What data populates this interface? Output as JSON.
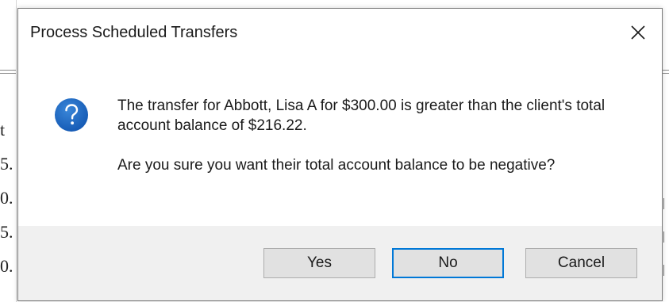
{
  "background": {
    "fragments": [
      "t",
      "5.",
      "0.",
      "5.",
      "0."
    ]
  },
  "dialog": {
    "title": "Process Scheduled Transfers",
    "icon": "question-icon",
    "message_line1": "The transfer for Abbott, Lisa A for $300.00 is greater than the client's total account balance of $216.22.",
    "message_line2": "Are you sure you want their total account balance to be negative?",
    "buttons": {
      "yes": "Yes",
      "no": "No",
      "cancel": "Cancel"
    },
    "default_button": "No"
  },
  "colors": {
    "accent": "#0078d7",
    "icon_blue": "#1565c0",
    "footer": "#f0f0f0"
  }
}
